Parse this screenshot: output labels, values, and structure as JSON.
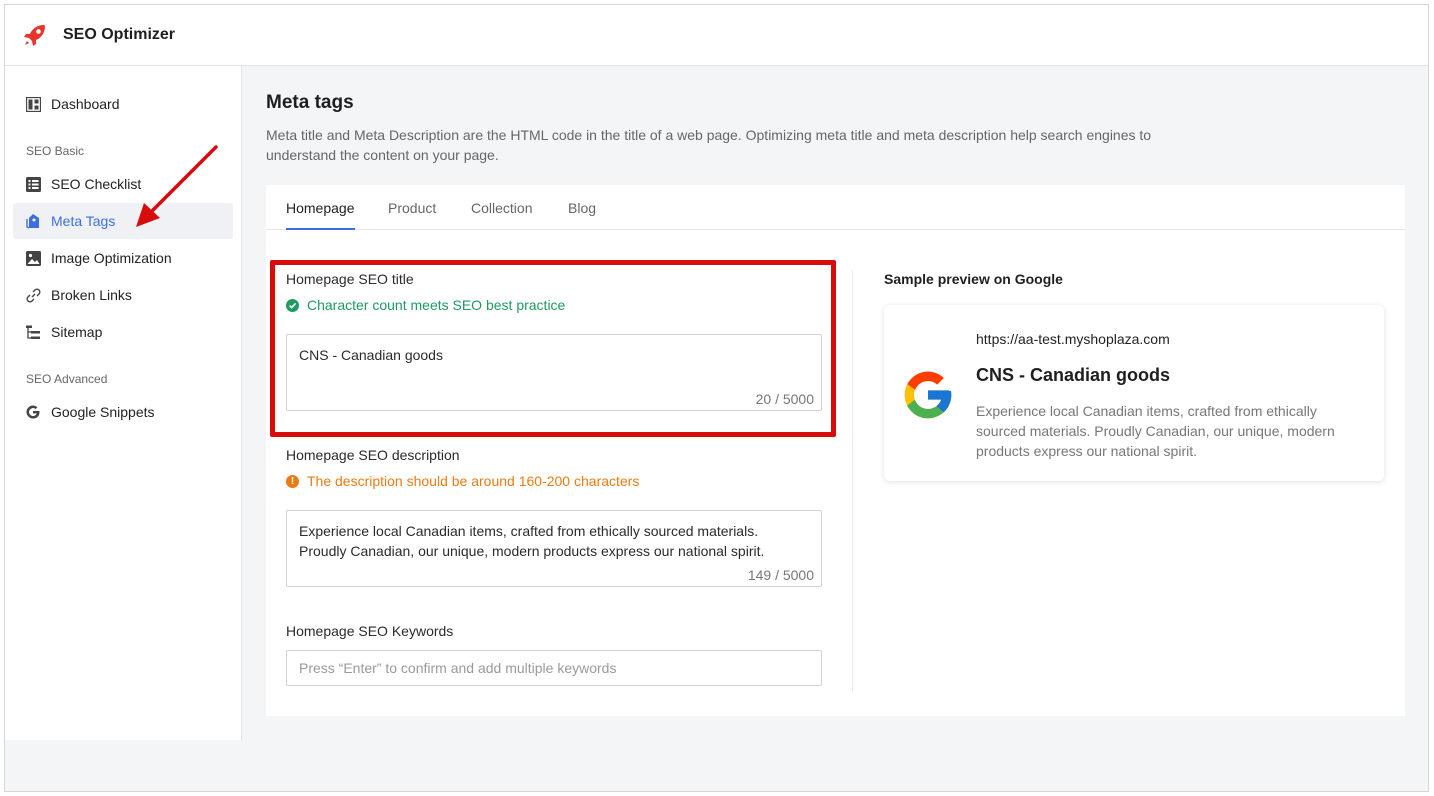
{
  "app": {
    "title": "SEO Optimizer",
    "logo_icon": "rocket-icon",
    "accent": "#3b6fde",
    "logo_color": "#e8342b"
  },
  "sidebar": {
    "dashboard": {
      "label": "Dashboard",
      "icon": "dashboard-icon"
    },
    "section_basic": "SEO Basic",
    "basic_items": [
      {
        "label": "SEO Checklist",
        "icon": "checklist-icon"
      },
      {
        "label": "Meta Tags",
        "icon": "tag-icon",
        "active": true
      },
      {
        "label": "Image Optimization",
        "icon": "image-icon"
      },
      {
        "label": "Broken Links",
        "icon": "link-icon"
      },
      {
        "label": "Sitemap",
        "icon": "sitemap-icon"
      }
    ],
    "section_advanced": "SEO Advanced",
    "advanced_items": [
      {
        "label": "Google Snippets",
        "icon": "google-icon"
      }
    ]
  },
  "main": {
    "title": "Meta tags",
    "description": "Meta title and Meta Description are the HTML code in the title of a web page. Optimizing meta title and meta description help search engines to understand the content on your page.",
    "tabs": [
      "Homepage",
      "Product",
      "Collection",
      "Blog"
    ],
    "active_tab": "Homepage"
  },
  "form": {
    "seo_title": {
      "label": "Homepage SEO title",
      "hint": "Character count meets SEO best practice",
      "value": "CNS - Canadian goods",
      "count": "20 / 5000"
    },
    "seo_description": {
      "label": "Homepage SEO description",
      "hint": "The description should be around 160-200 characters",
      "value": "Experience local Canadian items, crafted from ethically sourced materials. Proudly Canadian, our unique, modern products express our national spirit.",
      "count": "149 / 5000"
    },
    "seo_keywords": {
      "label": "Homepage SEO Keywords",
      "placeholder": "Press “Enter” to confirm and add multiple keywords"
    }
  },
  "preview": {
    "heading": "Sample preview on Google",
    "url": "https://aa-test.myshoplaza.com",
    "title": "CNS - Canadian goods",
    "description": "Experience local Canadian items, crafted from ethically sourced materials. Proudly Canadian, our unique, modern products express our national spirit."
  },
  "colors": {
    "success": "#1e9a62",
    "warning": "#ea7b12",
    "annotation": "#d90c0c"
  }
}
